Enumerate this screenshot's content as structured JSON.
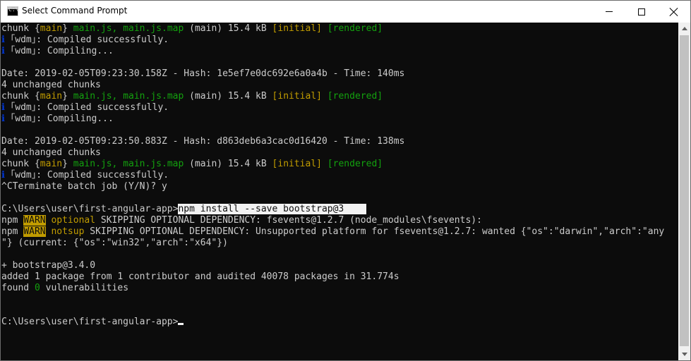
{
  "window": {
    "title": "Select Command Prompt"
  },
  "console": {
    "lines": [
      {
        "segments": [
          {
            "t": "chunk {",
            "c": ""
          },
          {
            "t": "main",
            "c": "y"
          },
          {
            "t": "} ",
            "c": ""
          },
          {
            "t": "main.js, main.js.map",
            "c": "g"
          },
          {
            "t": " (main) 15.4 kB ",
            "c": ""
          },
          {
            "t": "[initial]",
            "c": "y"
          },
          {
            "t": " ",
            "c": ""
          },
          {
            "t": "[rendered]",
            "c": "g"
          }
        ]
      },
      {
        "segments": [
          {
            "t": "ℹ",
            "c": "b"
          },
          {
            "t": " ｢wdm｣: Compiled successfully.",
            "c": ""
          }
        ]
      },
      {
        "segments": [
          {
            "t": "ℹ",
            "c": "b"
          },
          {
            "t": " ｢wdm｣: Compiling...",
            "c": ""
          }
        ]
      },
      {
        "segments": [
          {
            "t": "",
            "c": ""
          }
        ]
      },
      {
        "segments": [
          {
            "t": "Date: 2019-02-05T09:23:30.158Z - Hash: 1e5ef7e0dc692e6a0a4b - Time: 140ms",
            "c": ""
          }
        ]
      },
      {
        "segments": [
          {
            "t": "4 unchanged chunks",
            "c": ""
          }
        ]
      },
      {
        "segments": [
          {
            "t": "chunk {",
            "c": ""
          },
          {
            "t": "main",
            "c": "y"
          },
          {
            "t": "} ",
            "c": ""
          },
          {
            "t": "main.js, main.js.map",
            "c": "g"
          },
          {
            "t": " (main) 15.4 kB ",
            "c": ""
          },
          {
            "t": "[initial]",
            "c": "y"
          },
          {
            "t": " ",
            "c": ""
          },
          {
            "t": "[rendered]",
            "c": "g"
          }
        ]
      },
      {
        "segments": [
          {
            "t": "ℹ",
            "c": "b"
          },
          {
            "t": " ｢wdm｣: Compiled successfully.",
            "c": ""
          }
        ]
      },
      {
        "segments": [
          {
            "t": "ℹ",
            "c": "b"
          },
          {
            "t": " ｢wdm｣: Compiling...",
            "c": ""
          }
        ]
      },
      {
        "segments": [
          {
            "t": "",
            "c": ""
          }
        ]
      },
      {
        "segments": [
          {
            "t": "Date: 2019-02-05T09:23:50.883Z - Hash: d863deb6a3cac0d16420 - Time: 138ms",
            "c": ""
          }
        ]
      },
      {
        "segments": [
          {
            "t": "4 unchanged chunks",
            "c": ""
          }
        ]
      },
      {
        "segments": [
          {
            "t": "chunk {",
            "c": ""
          },
          {
            "t": "main",
            "c": "y"
          },
          {
            "t": "} ",
            "c": ""
          },
          {
            "t": "main.js, main.js.map",
            "c": "g"
          },
          {
            "t": " (main) 15.4 kB ",
            "c": ""
          },
          {
            "t": "[initial]",
            "c": "y"
          },
          {
            "t": " ",
            "c": ""
          },
          {
            "t": "[rendered]",
            "c": "g"
          }
        ]
      },
      {
        "segments": [
          {
            "t": "ℹ",
            "c": "b"
          },
          {
            "t": " ｢wdm｣: Compiled successfully.",
            "c": ""
          }
        ]
      },
      {
        "segments": [
          {
            "t": "^CTerminate batch job (Y/N)? y",
            "c": ""
          }
        ]
      },
      {
        "segments": [
          {
            "t": "",
            "c": ""
          }
        ]
      },
      {
        "segments": [
          {
            "t": "C:\\Users\\user\\first-angular-app>",
            "c": ""
          },
          {
            "t": "npm install --save bootstrap@3    ",
            "c": "sel"
          }
        ]
      },
      {
        "segments": [
          {
            "t": "npm ",
            "c": ""
          },
          {
            "t": "WARN",
            "c": "warn"
          },
          {
            "t": " ",
            "c": ""
          },
          {
            "t": "optional",
            "c": "y"
          },
          {
            "t": " SKIPPING OPTIONAL DEPENDENCY: fsevents@1.2.7 (node_modules\\fsevents):",
            "c": ""
          }
        ]
      },
      {
        "segments": [
          {
            "t": "npm ",
            "c": ""
          },
          {
            "t": "WARN",
            "c": "warn"
          },
          {
            "t": " ",
            "c": ""
          },
          {
            "t": "notsup",
            "c": "y"
          },
          {
            "t": " SKIPPING OPTIONAL DEPENDENCY: Unsupported platform for fsevents@1.2.7: wanted {\"os\":\"darwin\",\"arch\":\"any",
            "c": ""
          }
        ]
      },
      {
        "segments": [
          {
            "t": "\"} (current: {\"os\":\"win32\",\"arch\":\"x64\"})",
            "c": ""
          }
        ]
      },
      {
        "segments": [
          {
            "t": "",
            "c": ""
          }
        ]
      },
      {
        "segments": [
          {
            "t": "+ bootstrap@3.4.0",
            "c": ""
          }
        ]
      },
      {
        "segments": [
          {
            "t": "added 1 package from 1 contributor and audited 40078 packages in 31.774s",
            "c": ""
          }
        ]
      },
      {
        "segments": [
          {
            "t": "found ",
            "c": ""
          },
          {
            "t": "0",
            "c": "g"
          },
          {
            "t": " vulnerabilities",
            "c": ""
          }
        ]
      },
      {
        "segments": [
          {
            "t": "",
            "c": ""
          }
        ]
      },
      {
        "segments": [
          {
            "t": "",
            "c": ""
          }
        ]
      },
      {
        "segments": [
          {
            "t": "C:\\Users\\user\\first-angular-app>",
            "c": ""
          },
          {
            "t": "",
            "c": "cursor"
          }
        ]
      }
    ]
  }
}
